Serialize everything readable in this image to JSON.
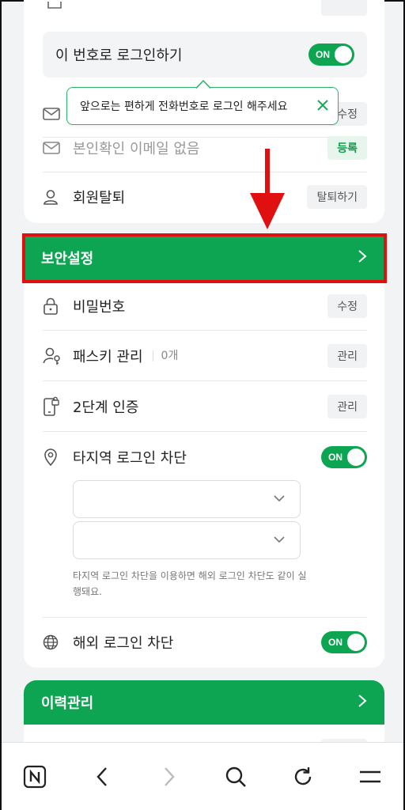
{
  "account": {
    "login_with_number": {
      "label": "이 번호로 로그인하기",
      "toggle": "ON"
    },
    "tooltip": {
      "text": "앞으로는 편하게 전화번호로 로그인 해주세요"
    },
    "email_row": {
      "edit_label": "수정"
    },
    "verify_email": {
      "label": "본인확인 이메일 없음",
      "action": "등록"
    },
    "withdraw": {
      "label": "회원탈퇴",
      "action": "탈퇴하기"
    }
  },
  "security": {
    "title": "보안설정",
    "password": {
      "label": "비밀번호",
      "action": "수정"
    },
    "passkey": {
      "label": "패스키 관리",
      "count": "0개",
      "action": "관리"
    },
    "two_factor": {
      "label": "2단계 인증",
      "action": "관리"
    },
    "region_block": {
      "label": "타지역 로그인 차단",
      "toggle": "ON"
    },
    "region_note": "타지역 로그인 차단을 이용하면 해외 로그인 차단도 같이 실행돼요.",
    "foreign_block": {
      "label": "해외 로그인 차단",
      "toggle": "ON"
    }
  },
  "history": {
    "title": "이력관리"
  },
  "colors": {
    "brand": "#0ea552",
    "highlight": "#e01010"
  }
}
